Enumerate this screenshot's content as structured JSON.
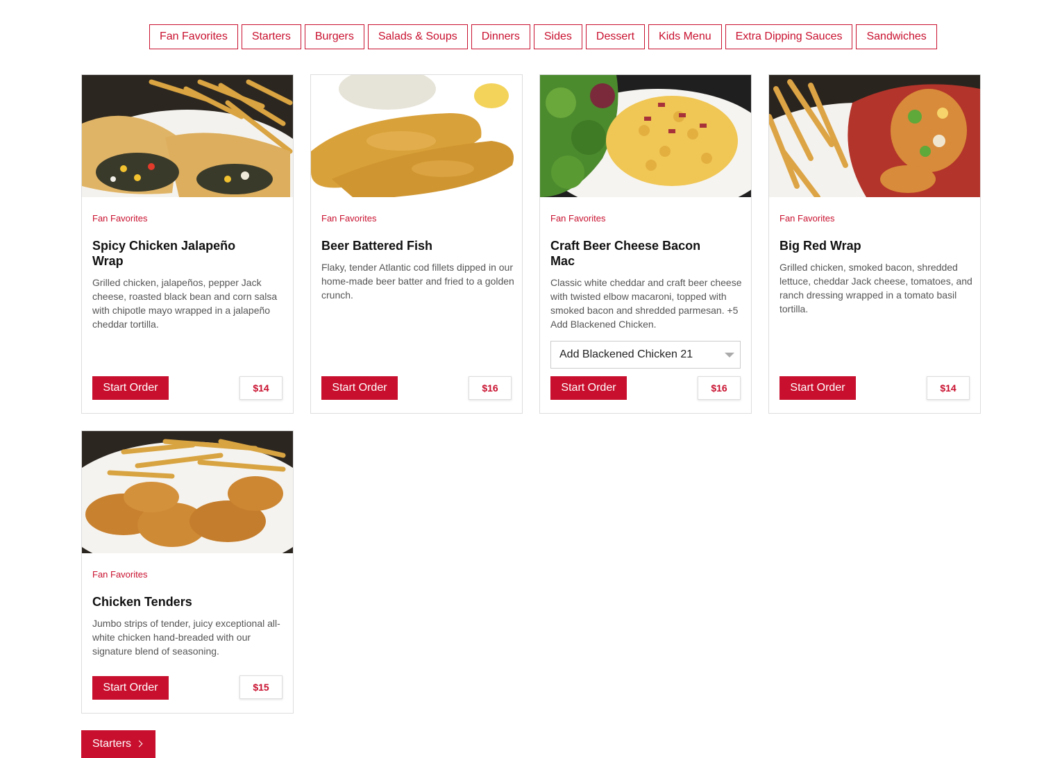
{
  "nav": {
    "tabs": [
      "Fan Favorites",
      "Starters",
      "Burgers",
      "Salads & Soups",
      "Dinners",
      "Sides",
      "Dessert",
      "Kids Menu",
      "Extra Dipping Sauces",
      "Sandwiches"
    ]
  },
  "colors": {
    "accent": "#c8102e",
    "border": "#dddddd",
    "muted_text": "#555555"
  },
  "items": [
    {
      "category": "Fan Favorites",
      "title": "Spicy Chicken Jalapeño Wrap",
      "description": "Grilled chicken, jalapeños, pepper Jack cheese, roasted black bean and corn salsa with chipotle mayo wrapped in a jalapeño cheddar tortilla.",
      "button": "Start Order",
      "price": "$14"
    },
    {
      "category": "Fan Favorites",
      "title": "Beer Battered Fish",
      "description": "Flaky, tender Atlantic cod fillets dipped in our home-made beer batter and fried to a golden crunch.",
      "button": "Start Order",
      "price": "$16"
    },
    {
      "category": "Fan Favorites",
      "title": "Craft Beer Cheese Bacon Mac",
      "description": "Classic white cheddar and craft beer cheese with twisted elbow macaroni, topped with smoked bacon and shredded parmesan. +5 Add Blackened Chicken.",
      "option": "Add Blackened Chicken 21",
      "button": "Start Order",
      "price": "$16"
    },
    {
      "category": "Fan Favorites",
      "title": "Big Red Wrap",
      "description": "Grilled chicken, smoked bacon, shredded lettuce, cheddar Jack cheese, tomatoes, and ranch dressing wrapped in a tomato basil tortilla.",
      "button": "Start Order",
      "price": "$14"
    },
    {
      "category": "Fan Favorites",
      "title": "Chicken Tenders",
      "description": "Jumbo strips of tender, juicy exceptional all-white chicken hand-breaded with our signature blend of seasoning.",
      "button": "Start Order",
      "price": "$15"
    }
  ],
  "next_section": {
    "label": "Starters",
    "icon": "chevron-right-icon"
  }
}
